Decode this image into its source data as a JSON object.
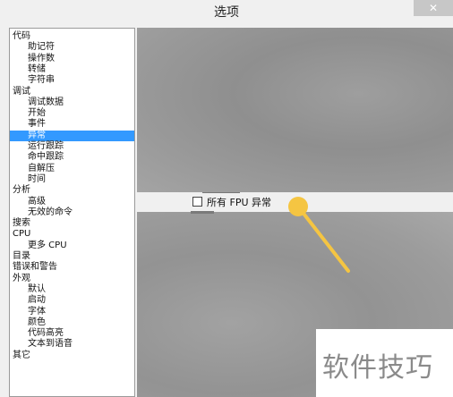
{
  "window": {
    "title": "选项",
    "close_label": "✕"
  },
  "tree": {
    "items": [
      {
        "label": "代码",
        "level": 0
      },
      {
        "label": "助记符",
        "level": 1
      },
      {
        "label": "操作数",
        "level": 1
      },
      {
        "label": "转储",
        "level": 1
      },
      {
        "label": "字符串",
        "level": 1
      },
      {
        "label": "调试",
        "level": 0
      },
      {
        "label": "调试数据",
        "level": 1
      },
      {
        "label": "开始",
        "level": 1
      },
      {
        "label": "事件",
        "level": 1
      },
      {
        "label": "异常",
        "level": 1,
        "selected": true
      },
      {
        "label": "运行跟踪",
        "level": 1
      },
      {
        "label": "命中跟踪",
        "level": 1
      },
      {
        "label": "自解压",
        "level": 1
      },
      {
        "label": "时间",
        "level": 1
      },
      {
        "label": "分析",
        "level": 0
      },
      {
        "label": "高级",
        "level": 1
      },
      {
        "label": "无效的命令",
        "level": 1
      },
      {
        "label": "搜索",
        "level": 0
      },
      {
        "label": "CPU",
        "level": 0
      },
      {
        "label": "更多 CPU",
        "level": 1
      },
      {
        "label": "目录",
        "level": 0
      },
      {
        "label": "错误和警告",
        "level": 0
      },
      {
        "label": "外观",
        "level": 0
      },
      {
        "label": "默认",
        "level": 1
      },
      {
        "label": "启动",
        "level": 1
      },
      {
        "label": "字体",
        "level": 1
      },
      {
        "label": "颜色",
        "level": 1
      },
      {
        "label": "代码高亮",
        "level": 1
      },
      {
        "label": "文本到语音",
        "level": 1
      },
      {
        "label": "其它",
        "level": 0
      }
    ]
  },
  "exceptions": {
    "all_fpu_label": "所有 FPU 异常",
    "all_fpu_checked": false
  },
  "annotation": {
    "color": "#f5c542"
  },
  "watermark": {
    "text": "软件技巧"
  }
}
